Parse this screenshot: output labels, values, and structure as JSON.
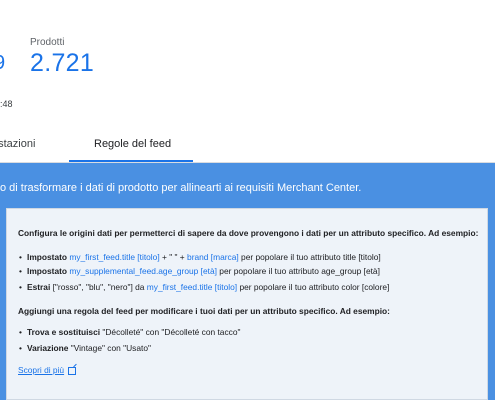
{
  "stats": {
    "clipped_value": "9",
    "products_label": "Prodotti",
    "products_value": "2.721",
    "clipped_time": ":48"
  },
  "tabs": [
    {
      "label": "ostazioni"
    },
    {
      "label": "Regole del feed"
    }
  ],
  "banner": {
    "title": "o di trasformare i dati di prodotto per allinearti ai requisiti Merchant Center."
  },
  "card": {
    "intro": "Configura le origini dati per permetterci di sapere da dove provengono i dati per un attributo specifico. Ad esempio:",
    "rows": [
      {
        "bold": "Impostato",
        "link1": "my_first_feed.title [titolo]",
        "mid": "+ \" \" +",
        "link2": "brand [marca]",
        "tail": "per popolare il tuo attributo title [titolo]"
      },
      {
        "bold": "Impostato",
        "link1": "my_supplemental_feed.age_group [età]",
        "tail": "per popolare il tuo attributo age_group [età]"
      },
      {
        "bold": "Estrai",
        "text1": "[\"rosso\", \"blu\", \"nero\"] da",
        "link1": "my_first_feed.title [titolo]",
        "tail": "per popolare il tuo attributo color [colore]"
      }
    ],
    "intro2": "Aggiungi una regola del feed per modificare i tuoi dati per un attributo specifico. Ad esempio:",
    "rows2": [
      {
        "bold": "Trova e sostituisci",
        "text": "\"Décolleté\" con \"Décolleté con tacco\""
      },
      {
        "bold": "Variazione",
        "text": "\"Vintage\" con \"Usato\""
      }
    ],
    "learn_more": "Scopri di più"
  },
  "colors": {
    "accent": "#1a73e8",
    "banner": "#4a90e2",
    "card": "#eef3f9"
  }
}
